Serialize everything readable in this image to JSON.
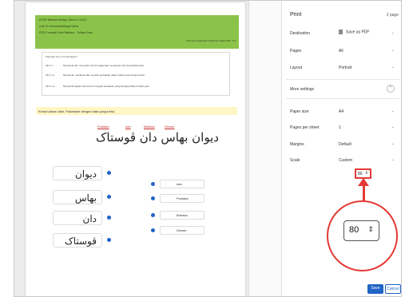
{
  "preview": {
    "header": {
      "line1": "KSSR Bahasa Melayu Tahun 3 SJKC",
      "line2": "Unit 10: Bermainlestinga Sains",
      "line3": "PDE Formatif: Seni Bahasa - Tulisan Jawi",
      "right_note": "Nota dan penyelesaian di halaman terakhir PdP... Kini"
    },
    "objectives": {
      "title": "Standard Guru: Pembelajaran",
      "rows": [
        {
          "code": "SP 4.1",
          "text": "Mengenal dan menyebut huruf tunggal dan mengecam huruf perkataan jawi."
        },
        {
          "code": "SP 4.1.1",
          "text": "Mengenal, membaca dan menulis perkataan dalam tulisan jawi dengan betul."
        },
        {
          "code": "SP 4.1.2",
          "text": "Menyambungkan huruf-huruf menjadi perkataan yang lengkap dalam tulisan jawi."
        }
      ]
    },
    "instruction": "Kenal tulisan Jawi. Padankan dengan kata yang betul.",
    "glosses": [
      "Pustaka",
      "dan",
      "Bahasa",
      "Dewan"
    ],
    "jawi_sentence": "ديوان بهاس دان ڤوستاک",
    "left_words": [
      "ديوان",
      "بهاس",
      "دان",
      "ڤوستاک"
    ],
    "right_words": [
      "dan",
      "Pustaka",
      "Bahasa",
      "Dewan"
    ]
  },
  "panel": {
    "title": "Print",
    "page_count": "2 page",
    "destination": {
      "label": "Destination",
      "value": "Save as PDF"
    },
    "pages": {
      "label": "Pages",
      "value": "All"
    },
    "layout": {
      "label": "Layout",
      "value": "Portrait"
    },
    "more_settings": "More settings",
    "paper_size": {
      "label": "Paper size",
      "value": "A4"
    },
    "pages_per_sheet": {
      "label": "Pages per sheet",
      "value": "1"
    },
    "margins": {
      "label": "Margins",
      "value": "Default"
    },
    "scale": {
      "label": "Scale",
      "value": "Custom"
    },
    "scale_input": "80",
    "zoom_value": "80",
    "save_label": "Save",
    "cancel_label": "Cancel"
  },
  "colors": {
    "accent": "#1e63c6",
    "highlight": "#e53935",
    "header_green": "#8bc34a"
  }
}
